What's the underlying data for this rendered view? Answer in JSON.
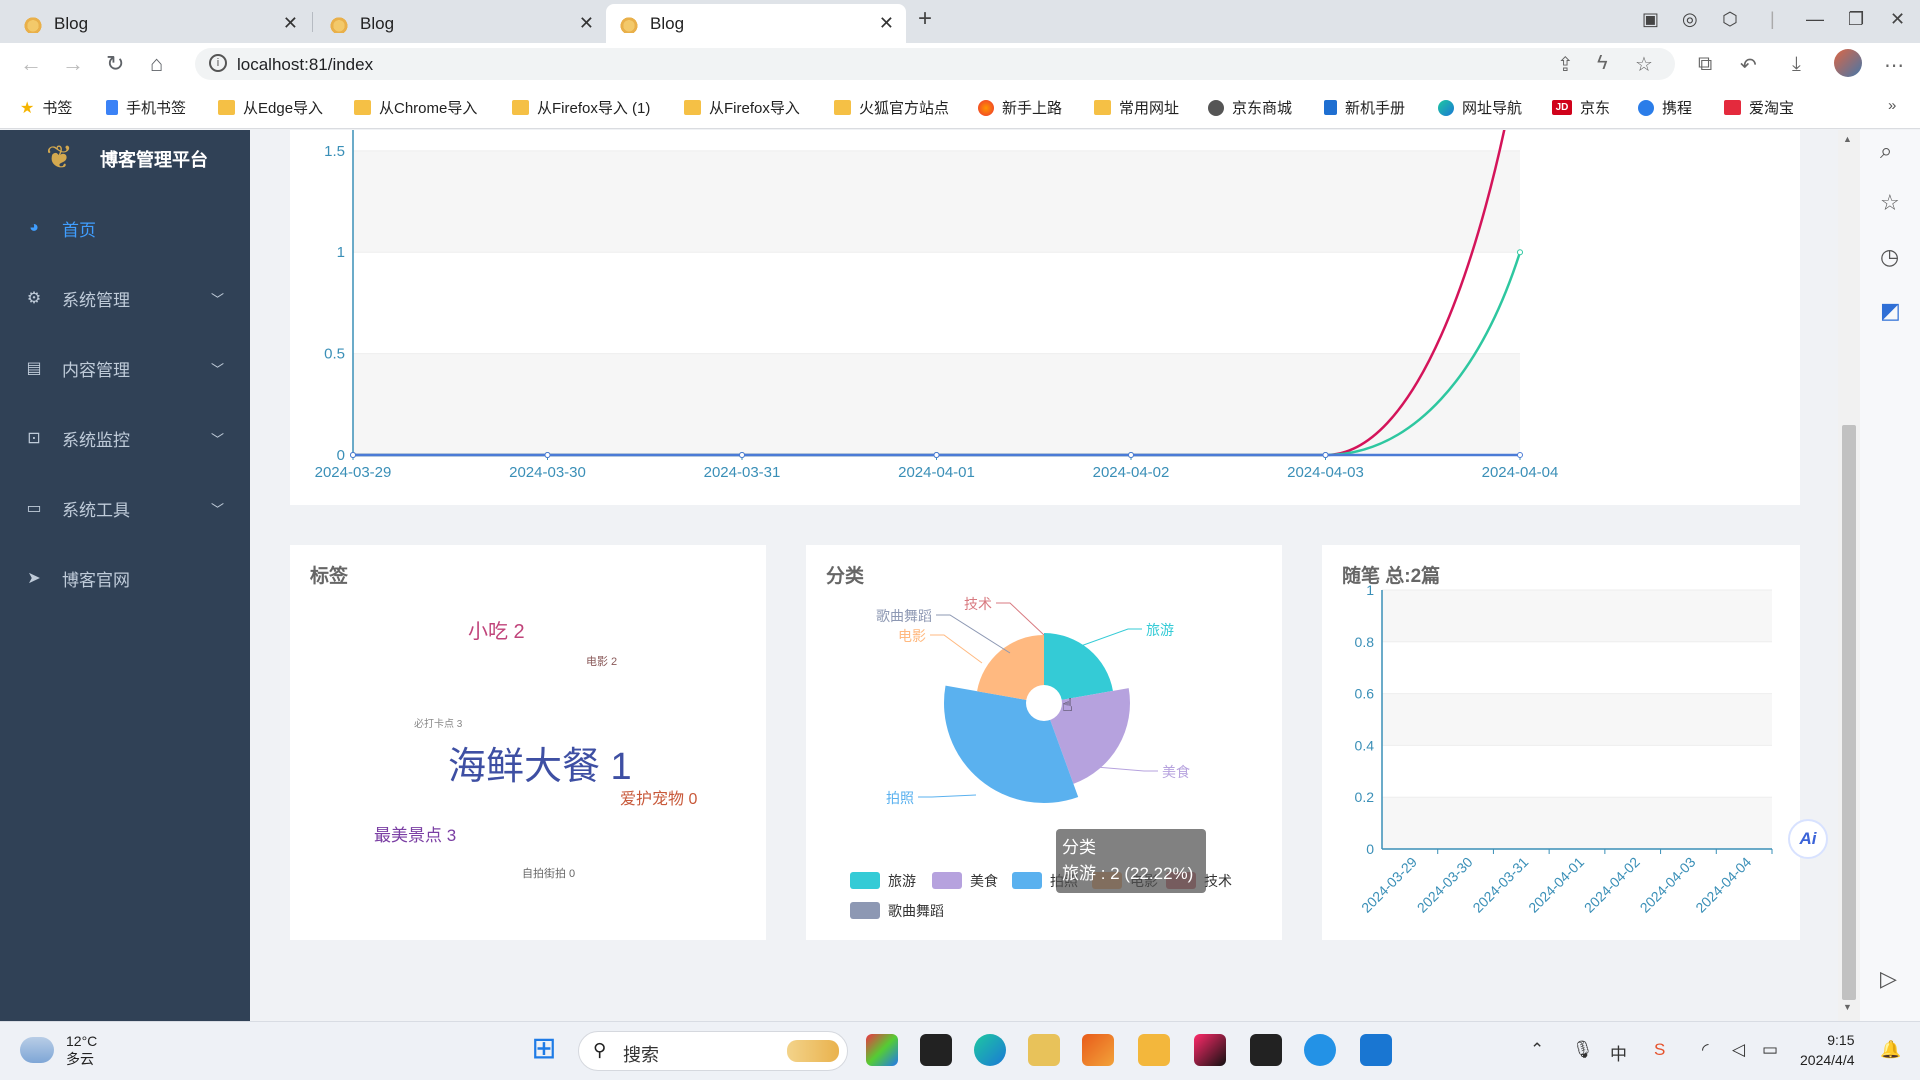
{
  "browser": {
    "tabs": [
      {
        "title": "Blog",
        "active": false
      },
      {
        "title": "Blog",
        "active": false
      },
      {
        "title": "Blog",
        "active": true
      }
    ],
    "new_tab": "+",
    "url": "localhost:81/index",
    "bookmarks": [
      {
        "label": "书签",
        "icon": "star-icon"
      },
      {
        "label": "手机书签",
        "icon": "phone-icon"
      },
      {
        "label": "从Edge导入",
        "icon": "folder-icon"
      },
      {
        "label": "从Chrome导入",
        "icon": "folder-icon"
      },
      {
        "label": "从Firefox导入 (1)",
        "icon": "folder-icon"
      },
      {
        "label": "从Firefox导入",
        "icon": "folder-icon"
      },
      {
        "label": "火狐官方站点",
        "icon": "folder-icon"
      },
      {
        "label": "新手上路",
        "icon": "firefox-icon"
      },
      {
        "label": "常用网址",
        "icon": "folder-icon"
      },
      {
        "label": "京东商城",
        "icon": "globe-icon"
      },
      {
        "label": "新机手册",
        "icon": "doc-icon"
      },
      {
        "label": "网址导航",
        "icon": "edge-icon"
      },
      {
        "label": "京东",
        "icon": "jd-icon"
      },
      {
        "label": "携程",
        "icon": "ctrip-icon"
      },
      {
        "label": "爱淘宝",
        "icon": "taobao-icon"
      }
    ]
  },
  "sidebar": {
    "title": "博客管理平台",
    "items": [
      {
        "label": "首页",
        "active": true,
        "icon": "dashboard-icon"
      },
      {
        "label": "系统管理",
        "icon": "gear-icon"
      },
      {
        "label": "内容管理",
        "icon": "document-icon"
      },
      {
        "label": "系统监控",
        "icon": "monitor-icon"
      },
      {
        "label": "系统工具",
        "icon": "toolbox-icon"
      },
      {
        "label": "博客官网",
        "icon": "send-icon"
      }
    ]
  },
  "cards": {
    "tags_title": "标签",
    "category_title": "分类",
    "essay_title": "随笔 总:2篇"
  },
  "tag_cloud": [
    {
      "text": "小吃 2",
      "color": "#c0437a"
    },
    {
      "text": "电影 2",
      "color": "#8a5a5a"
    },
    {
      "text": "必打卡点 3",
      "color": "#888888"
    },
    {
      "text": "海鲜大餐 1",
      "color": "#3e4fa3"
    },
    {
      "text": "爱护宠物 0",
      "color": "#c8593a"
    },
    {
      "text": "最美景点 3",
      "color": "#7a3ea3"
    },
    {
      "text": "自拍街拍 0",
      "color": "#666666"
    }
  ],
  "tooltip": {
    "title": "分类",
    "line": "旅游 : 2 (22.22%)"
  },
  "chart_data": [
    {
      "type": "line",
      "categories": [
        "2024-03-29",
        "2024-03-30",
        "2024-03-31",
        "2024-04-01",
        "2024-04-02",
        "2024-04-03",
        "2024-04-04"
      ],
      "ylim": [
        0,
        1.8
      ],
      "yticks": [
        "0",
        "0.5",
        "1",
        "1.5"
      ],
      "series": [
        {
          "values": [
            0,
            0,
            0,
            0,
            0,
            0,
            2
          ],
          "color": "#d4145a"
        },
        {
          "values": [
            0,
            0,
            0,
            0,
            0,
            0,
            1
          ],
          "color": "#2ec7a0"
        },
        {
          "values": [
            0,
            0,
            0,
            0,
            0,
            0,
            0
          ],
          "color": "#4b7bd6"
        }
      ]
    },
    {
      "type": "pie",
      "title": "分类",
      "slices": [
        {
          "name": "旅游",
          "value": 2,
          "color": "#34cbd6"
        },
        {
          "name": "美食",
          "value": 2,
          "color": "#b6a2de"
        },
        {
          "name": "拍照",
          "value": 3,
          "color": "#5ab1ef"
        },
        {
          "name": "电影",
          "value": 2,
          "color": "#ffb980"
        },
        {
          "name": "技术",
          "value": 0,
          "color": "#d87a80"
        },
        {
          "name": "歌曲舞蹈",
          "value": 0,
          "color": "#8d98b3"
        }
      ],
      "legend": [
        "旅游",
        "美食",
        "拍照",
        "电影",
        "技术",
        "歌曲舞蹈"
      ]
    },
    {
      "type": "bar",
      "title": "随笔 总:2篇",
      "categories": [
        "2024-03-29",
        "2024-03-30",
        "2024-03-31",
        "2024-04-01",
        "2024-04-02",
        "2024-04-03",
        "2024-04-04"
      ],
      "values": [
        0,
        0,
        0,
        0,
        0,
        0,
        0
      ],
      "ylim": [
        0,
        1
      ],
      "yticks": [
        "0",
        "0.2",
        "0.4",
        "0.6",
        "0.8",
        "1"
      ]
    }
  ],
  "taskbar": {
    "weather_temp": "12°C",
    "weather_desc": "多云",
    "search_label": "搜索",
    "time": "9:15",
    "date": "2024/4/4"
  }
}
